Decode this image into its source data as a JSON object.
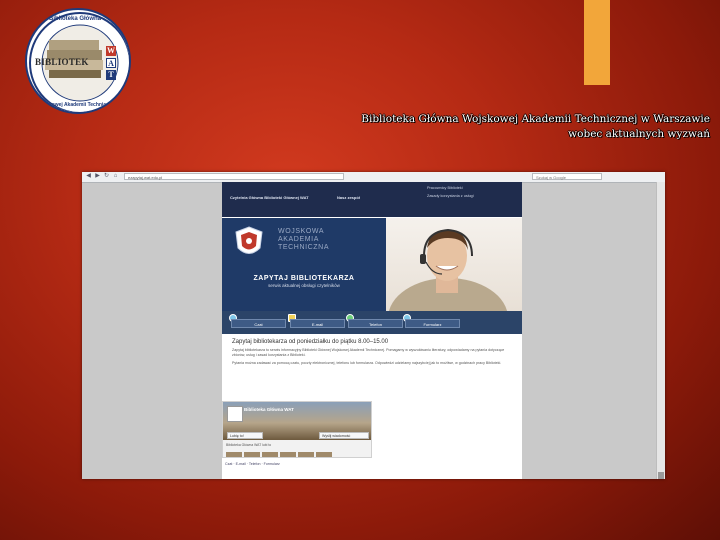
{
  "slide": {
    "title_line1": "Biblioteka Główna Wojskowej Akademii Technicznej w Warszawie",
    "title_line2": "wobec aktualnych wyzwań",
    "accent_color": "#f2a63a"
  },
  "logo": {
    "ring_top": "Biblioteka Główna",
    "ring_bottom": "Wojskowej Akademii Technicznej",
    "word": "BIBLIOTEK",
    "letters": [
      "W",
      "A",
      "T"
    ]
  },
  "browser": {
    "url": "ezapytaj.wat.edu.pl",
    "search_placeholder": "Szukaj w Google"
  },
  "site": {
    "nav": [
      "Czytelnia Główna Biblioteki Głównej WAT",
      "Nasz zespół"
    ],
    "side_links": [
      "Pracownicy Biblioteki",
      "Zasady korzystania z usługi"
    ],
    "hero_title_lines": [
      "WOJSKOWA",
      "AKADEMIA",
      "TECHNICZNA"
    ],
    "hero_caption": "ZAPYTAJ BIBLIOTEKARZA",
    "hero_subcaption": "serwis aktualnej obsługi czytelników",
    "buttons": [
      "Czat",
      "E-mail",
      "Telefon",
      "Formularz"
    ],
    "content_heading": "Zapytaj bibliotekarza od poniedziałku do piątku 8.00–15.00",
    "paragraphs": [
      "Zapytaj bibliotekarza to serwis informacyjny Biblioteki Głównej Wojskowej Akademii Technicznej. Pomagamy w wyszukiwaniu literatury, odpowiadamy na pytania dotyczące zbiorów, usług i zasad korzystania z Biblioteki.",
      "Pytania można zadawać za pomocą czatu, poczty elektronicznej, telefonu lub formularza. Odpowiedzi udzielamy najszybciej jak to możliwe, w godzinach pracy Biblioteki."
    ],
    "fb": {
      "name": "Biblioteka Główna WAT",
      "like_label": "Lubię to!",
      "message_label": "Wyślij wiadomość",
      "footer": "Biblioteka Główna WAT lubi to"
    },
    "footer_links": "Czat · E-mail · Telefon · Formularz"
  }
}
